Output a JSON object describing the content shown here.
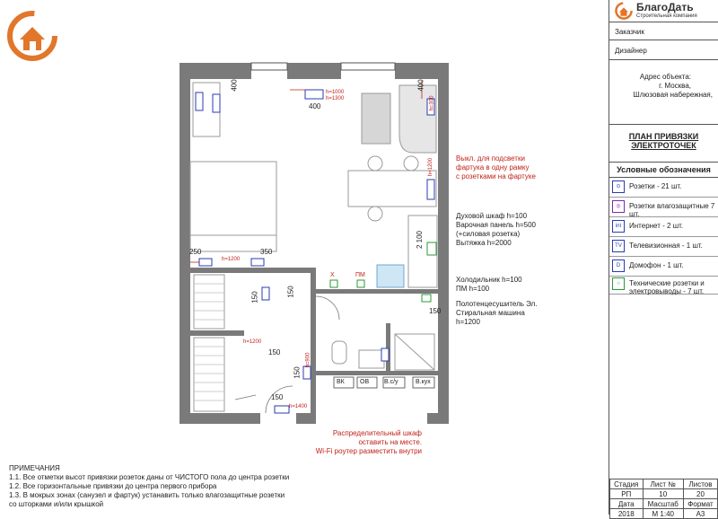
{
  "brand": {
    "name": "БлагоДать",
    "subtitle": "Строительная компания",
    "accent": "#e2762b"
  },
  "title_block": {
    "customer_label": "Заказчик",
    "designer_label": "Дизайнер",
    "address_label": "Адрес объекта:",
    "address_city": "г. Москва,",
    "address_street": "Шлюзовая набережная,",
    "plan_title_1": "ПЛАН ПРИВЯЗКИ",
    "plan_title_2": "ЭЛЕКТРОТОЧЕК",
    "legend_title": "Условные обозначения",
    "legend": [
      {
        "icon": "socket-icon",
        "glyph": "⊙",
        "label": "Розетки - 21 шт."
      },
      {
        "icon": "waterproof-socket-icon",
        "glyph": "◎",
        "label": "Розетки влагозащитные 7 шт."
      },
      {
        "icon": "internet-socket-icon",
        "glyph": "int",
        "label": "Интернет - 2 шт."
      },
      {
        "icon": "tv-socket-icon",
        "glyph": "TV",
        "label": "Телевизионная - 1 шт."
      },
      {
        "icon": "intercom-icon",
        "glyph": "D",
        "label": "Домофон - 1 шт."
      },
      {
        "icon": "technical-socket-icon",
        "glyph": "○",
        "label": "Технические розетки и электровыводы - 7 шт."
      }
    ]
  },
  "stamp": {
    "headers": [
      "Стадия",
      "Лист №",
      "Листов"
    ],
    "values": [
      "РП",
      "10",
      "20"
    ],
    "headers2": [
      "Дата",
      "Масштаб",
      "Формат"
    ],
    "values2": [
      "2018",
      "М 1:40",
      "А3"
    ]
  },
  "plan_labels": {
    "d400_top": "400",
    "d400_mid": "400",
    "d400_right": "400",
    "h1000": "h=1000",
    "h1300": "h=1300",
    "h300": "h=300",
    "h1200_right": "h=1200",
    "d250": "250",
    "d350": "350",
    "h1200_left": "h=1200",
    "d150_a": "150",
    "d150_b": "150",
    "d150_c": "150",
    "d150_d": "150",
    "d150_e": "150",
    "h1200_mid": "h=1200",
    "h900": "h=900",
    "h1400": "h=1400",
    "d150_bath": "150",
    "d2100": "2 100",
    "pm": "ПМ",
    "x": "X",
    "boxes": [
      "ВК",
      "ОВ",
      "В.с/у",
      "В.кух"
    ]
  },
  "annotations": {
    "backlight_1": "Выкл. для подсветки",
    "backlight_2": "фартука в одну рамку",
    "backlight_3": "с розетками на фартуке",
    "oven_1": "Духовой шкаф h=100",
    "oven_2": "Варочная панель h=500",
    "oven_3": "(+силовая розетка)",
    "oven_4": "Вытяжка h=2000",
    "fridge_1": "Холодильник h=100",
    "fridge_2": "ПМ h=100",
    "towel_1": "Полотенцесушитель Эл.",
    "towel_2": "Стиральная машина",
    "towel_3": "h=1200",
    "panel_1": "Распределительный шкаф",
    "panel_2": "оставить на месте.",
    "panel_3": "Wi-Fi роутер разместить внутри"
  },
  "notes": {
    "title": "ПРИМЕЧАНИЯ",
    "lines": [
      "1.1. Все отметки высот привязки розеток даны от ЧИСТОГО пола до центра розетки",
      "1.2. Все горизонтальные привязки до центра первого прибора",
      "1.3. В мокрых зонах (санузел и фартук) устанавить только влагозащитные розетки",
      "со шторками и/или крышкой"
    ]
  }
}
